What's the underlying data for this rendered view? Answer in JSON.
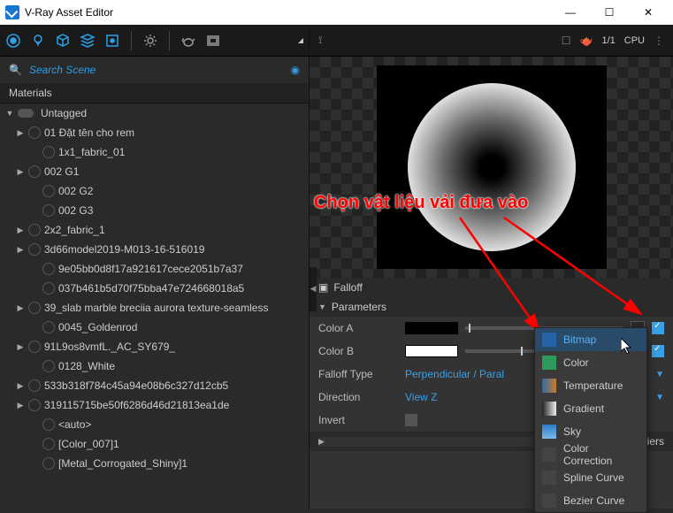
{
  "window": {
    "title": "V-Ray Asset Editor",
    "min": "—",
    "max": "☐",
    "close": "✕"
  },
  "toolbar": {
    "icons": [
      "target",
      "bulb",
      "cube",
      "layers",
      "frame",
      "gear",
      "teapot",
      "render"
    ]
  },
  "search": {
    "placeholder": "Search Scene"
  },
  "materials_header": "Materials",
  "tree": [
    {
      "level": 0,
      "arrow": "▼",
      "tag": true,
      "label": "Untagged"
    },
    {
      "level": 1,
      "arrow": "▶",
      "label": "01 Đặt tên cho rem"
    },
    {
      "level": 2,
      "arrow": "",
      "label": "1x1_fabric_01"
    },
    {
      "level": 1,
      "arrow": "▶",
      "label": "002 G1"
    },
    {
      "level": 2,
      "arrow": "",
      "label": "002 G2"
    },
    {
      "level": 2,
      "arrow": "",
      "label": "002 G3"
    },
    {
      "level": 1,
      "arrow": "▶",
      "label": "2x2_fabric_1"
    },
    {
      "level": 1,
      "arrow": "▶",
      "label": "3d66model2019-M013-16-516019"
    },
    {
      "level": 2,
      "arrow": "",
      "label": "9e05bb0d8f17a921617cece2051b7a37"
    },
    {
      "level": 2,
      "arrow": "",
      "label": "037b461b5d70f75bba47e724668018a5"
    },
    {
      "level": 1,
      "arrow": "▶",
      "label": "39_slab marble breciia aurora texture-seamless"
    },
    {
      "level": 2,
      "arrow": "",
      "label": "0045_Goldenrod"
    },
    {
      "level": 1,
      "arrow": "▶",
      "label": "91L9os8vmfL._AC_SY679_"
    },
    {
      "level": 2,
      "arrow": "",
      "label": "0128_White"
    },
    {
      "level": 1,
      "arrow": "▶",
      "label": "533b318f784c45a94e08b6c327d12cb5"
    },
    {
      "level": 1,
      "arrow": "▶",
      "label": "319115715be50f6286d46d21813ea1de"
    },
    {
      "level": 2,
      "arrow": "",
      "label": "<auto>"
    },
    {
      "level": 2,
      "arrow": "",
      "label": "[Color_007]1"
    },
    {
      "level": 2,
      "arrow": "",
      "label": "[Metal_Corrogated_Shiny]1"
    }
  ],
  "right_top": {
    "ratio": "1/1",
    "mode": "CPU"
  },
  "falloff_title": "Falloff",
  "parameters_title": "Parameters",
  "multipliers_title": "Multipliers",
  "params": {
    "colorA": {
      "label": "Color A",
      "hex": "#000000",
      "knob": 2
    },
    "colorB": {
      "label": "Color B",
      "hex": "#ffffff",
      "knob": 35
    },
    "falloff": {
      "label": "Falloff Type",
      "value": "Perpendicular / Paral"
    },
    "direction": {
      "label": "Direction",
      "value": "View Z"
    },
    "invert": {
      "label": "Invert"
    }
  },
  "dropdown": [
    {
      "label": "Bitmap",
      "hl": true,
      "color": "#2563a8"
    },
    {
      "label": "Color",
      "color": "#2e9a5e"
    },
    {
      "label": "Temperature",
      "color": "linear-gradient(90deg,#2b6bb0,#c87a2b)"
    },
    {
      "label": "Gradient",
      "color": "linear-gradient(90deg,#222,#eee)"
    },
    {
      "label": "Sky",
      "color": "linear-gradient(#2b7bc9,#7fb8e8)"
    },
    {
      "label": "Color Correction",
      "color": "#444"
    },
    {
      "label": "Spline Curve",
      "color": "#444"
    },
    {
      "label": "Bezier Curve",
      "color": "#444"
    }
  ],
  "annotation": "Chọn vật liệu vải đưa vào"
}
